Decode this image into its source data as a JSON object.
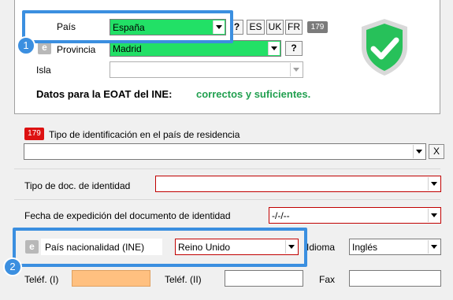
{
  "location": {
    "pais_label": "País",
    "pais_value": "España",
    "help_btn": "?",
    "lang_es": "ES",
    "lang_uk": "UK",
    "lang_fr": "FR",
    "count_badge": "179",
    "provincia_label": "Provincia",
    "provincia_value": "Madrid",
    "isla_label": "Isla",
    "isla_value": "",
    "eoat_label": "Datos para la EOAT del INE:",
    "eoat_status": "correctos y suficientes."
  },
  "identification": {
    "badge": "179",
    "tipo_id_label": "Tipo de identificación en el país de residencia",
    "tipo_id_value": "",
    "clear_btn": "X",
    "tipo_doc_label": "Tipo de doc. de identidad",
    "tipo_doc_value": "",
    "fecha_label": "Fecha de expedición del documento de identidad",
    "fecha_value": "-/-/--"
  },
  "nationality": {
    "e_icon": "e",
    "label": "País nacionalidad (INE)",
    "value": "Reino Unido",
    "idioma_label": "Idioma",
    "idioma_value": "Inglés"
  },
  "contact": {
    "telef1_label": "Teléf. (I)",
    "telef2_label": "Teléf. (II)",
    "fax_label": "Fax"
  },
  "callouts": {
    "one": "1",
    "two": "2"
  },
  "colors": {
    "valid_green": "#22e066",
    "accent_blue": "#3b8fe0",
    "error_red": "#c00000",
    "phone_fill": "#ffc080"
  }
}
